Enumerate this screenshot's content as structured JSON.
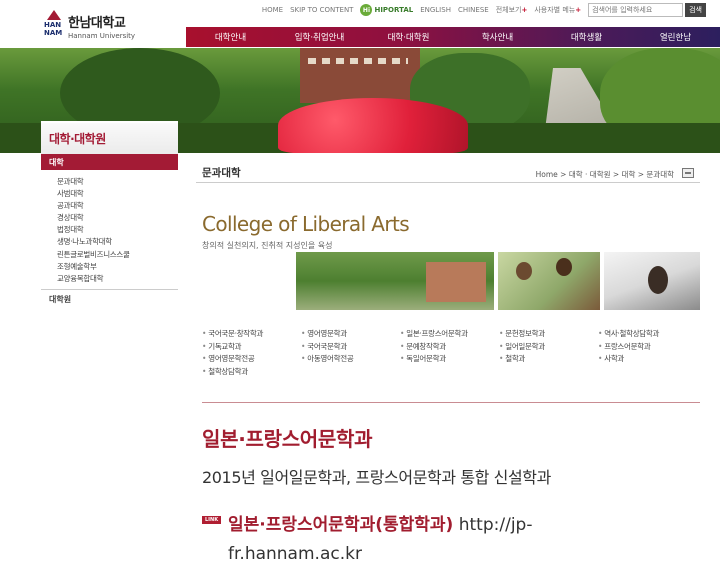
{
  "header": {
    "logo_ko": "한남대학교",
    "logo_en": "Hannam University",
    "logo_mark": "HAN NAM",
    "util_links": [
      "HOME",
      "SKIP TO CONTENT",
      "HIPORTAL",
      "ENGLISH",
      "CHINESE",
      "전체보기",
      "사용자별 메뉴"
    ],
    "search_placeholder": "검색어를 입력하세요",
    "search_button": "검색"
  },
  "gnb": [
    "대학안내",
    "입학·취업안내",
    "대학·대학원",
    "학사안내",
    "대학생활",
    "열린한남"
  ],
  "lnb": {
    "title": "대학·대학원",
    "category": "대학",
    "items": [
      "문과대학",
      "사범대학",
      "공과대학",
      "경상대학",
      "법정대학",
      "생명·나노과학대학",
      "린튼글로벌비즈니스스쿨",
      "조형예술학부",
      "교양융복합대학"
    ],
    "footer": "대학원"
  },
  "page": {
    "title": "문과대학",
    "breadcrumb": "Home > 대학 · 대학원 > 대학 > 문과대학",
    "college_en": "College of Liberal Arts",
    "college_ko": "창의적 실천의지, 진취적 지성인을 육성"
  },
  "departments": [
    "국어국문·창작학과",
    "영어영문학과",
    "일본·프랑스어문학과",
    "문헌정보학과",
    "역사·철학상담학과",
    "기독교학과",
    "국어국문학과",
    "문예창작학과",
    "일어일문학과",
    "프랑스어문학과",
    "영어영문학전공",
    "아동영어학전공",
    "독일어문학과",
    "철학과",
    "사학과",
    "철학상담학과"
  ],
  "dept_title": "일본·프랑스어문학과",
  "dept_desc": "2015년 일어일문학과, 프랑스어문학과 통합 신설학과",
  "link": {
    "badge": "LINK",
    "name": "일본·프랑스어문학과(통합학과)",
    "url": "http://jp-fr.hannam.ac.kr"
  },
  "colors": {
    "accent": "#a31b35",
    "gold": "#8a6a2e"
  }
}
